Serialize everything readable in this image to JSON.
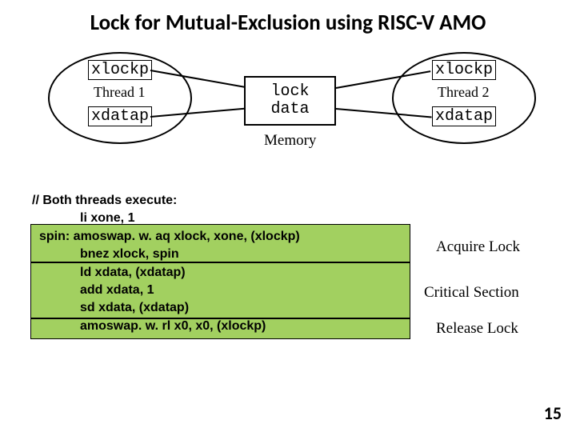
{
  "title": "Lock for Mutual-Exclusion using RISC-V AMO",
  "thread1": {
    "xlockp": "xlockp",
    "name": "Thread 1",
    "xdatap": "xdatap"
  },
  "thread2": {
    "xlockp": "xlockp",
    "name": "Thread 2",
    "xdatap": "xdatap"
  },
  "memory": {
    "lock": "lock",
    "data": "data",
    "label": "Memory"
  },
  "code": {
    "l0": "// Both threads execute:",
    "l1": "li xone, 1",
    "l2": "spin: amoswap. w. aq xlock, xone, (xlockp)",
    "l3": "bnez xlock, spin",
    "l4": "ld xdata, (xdatap)",
    "l5": "add xdata, 1",
    "l6": "sd xdata, (xdatap)",
    "l7": "amoswap. w. rl x0, x0, (xlockp)"
  },
  "labels": {
    "acquire": "Acquire Lock",
    "critical": "Critical Section",
    "release": "Release Lock"
  },
  "page": "15"
}
